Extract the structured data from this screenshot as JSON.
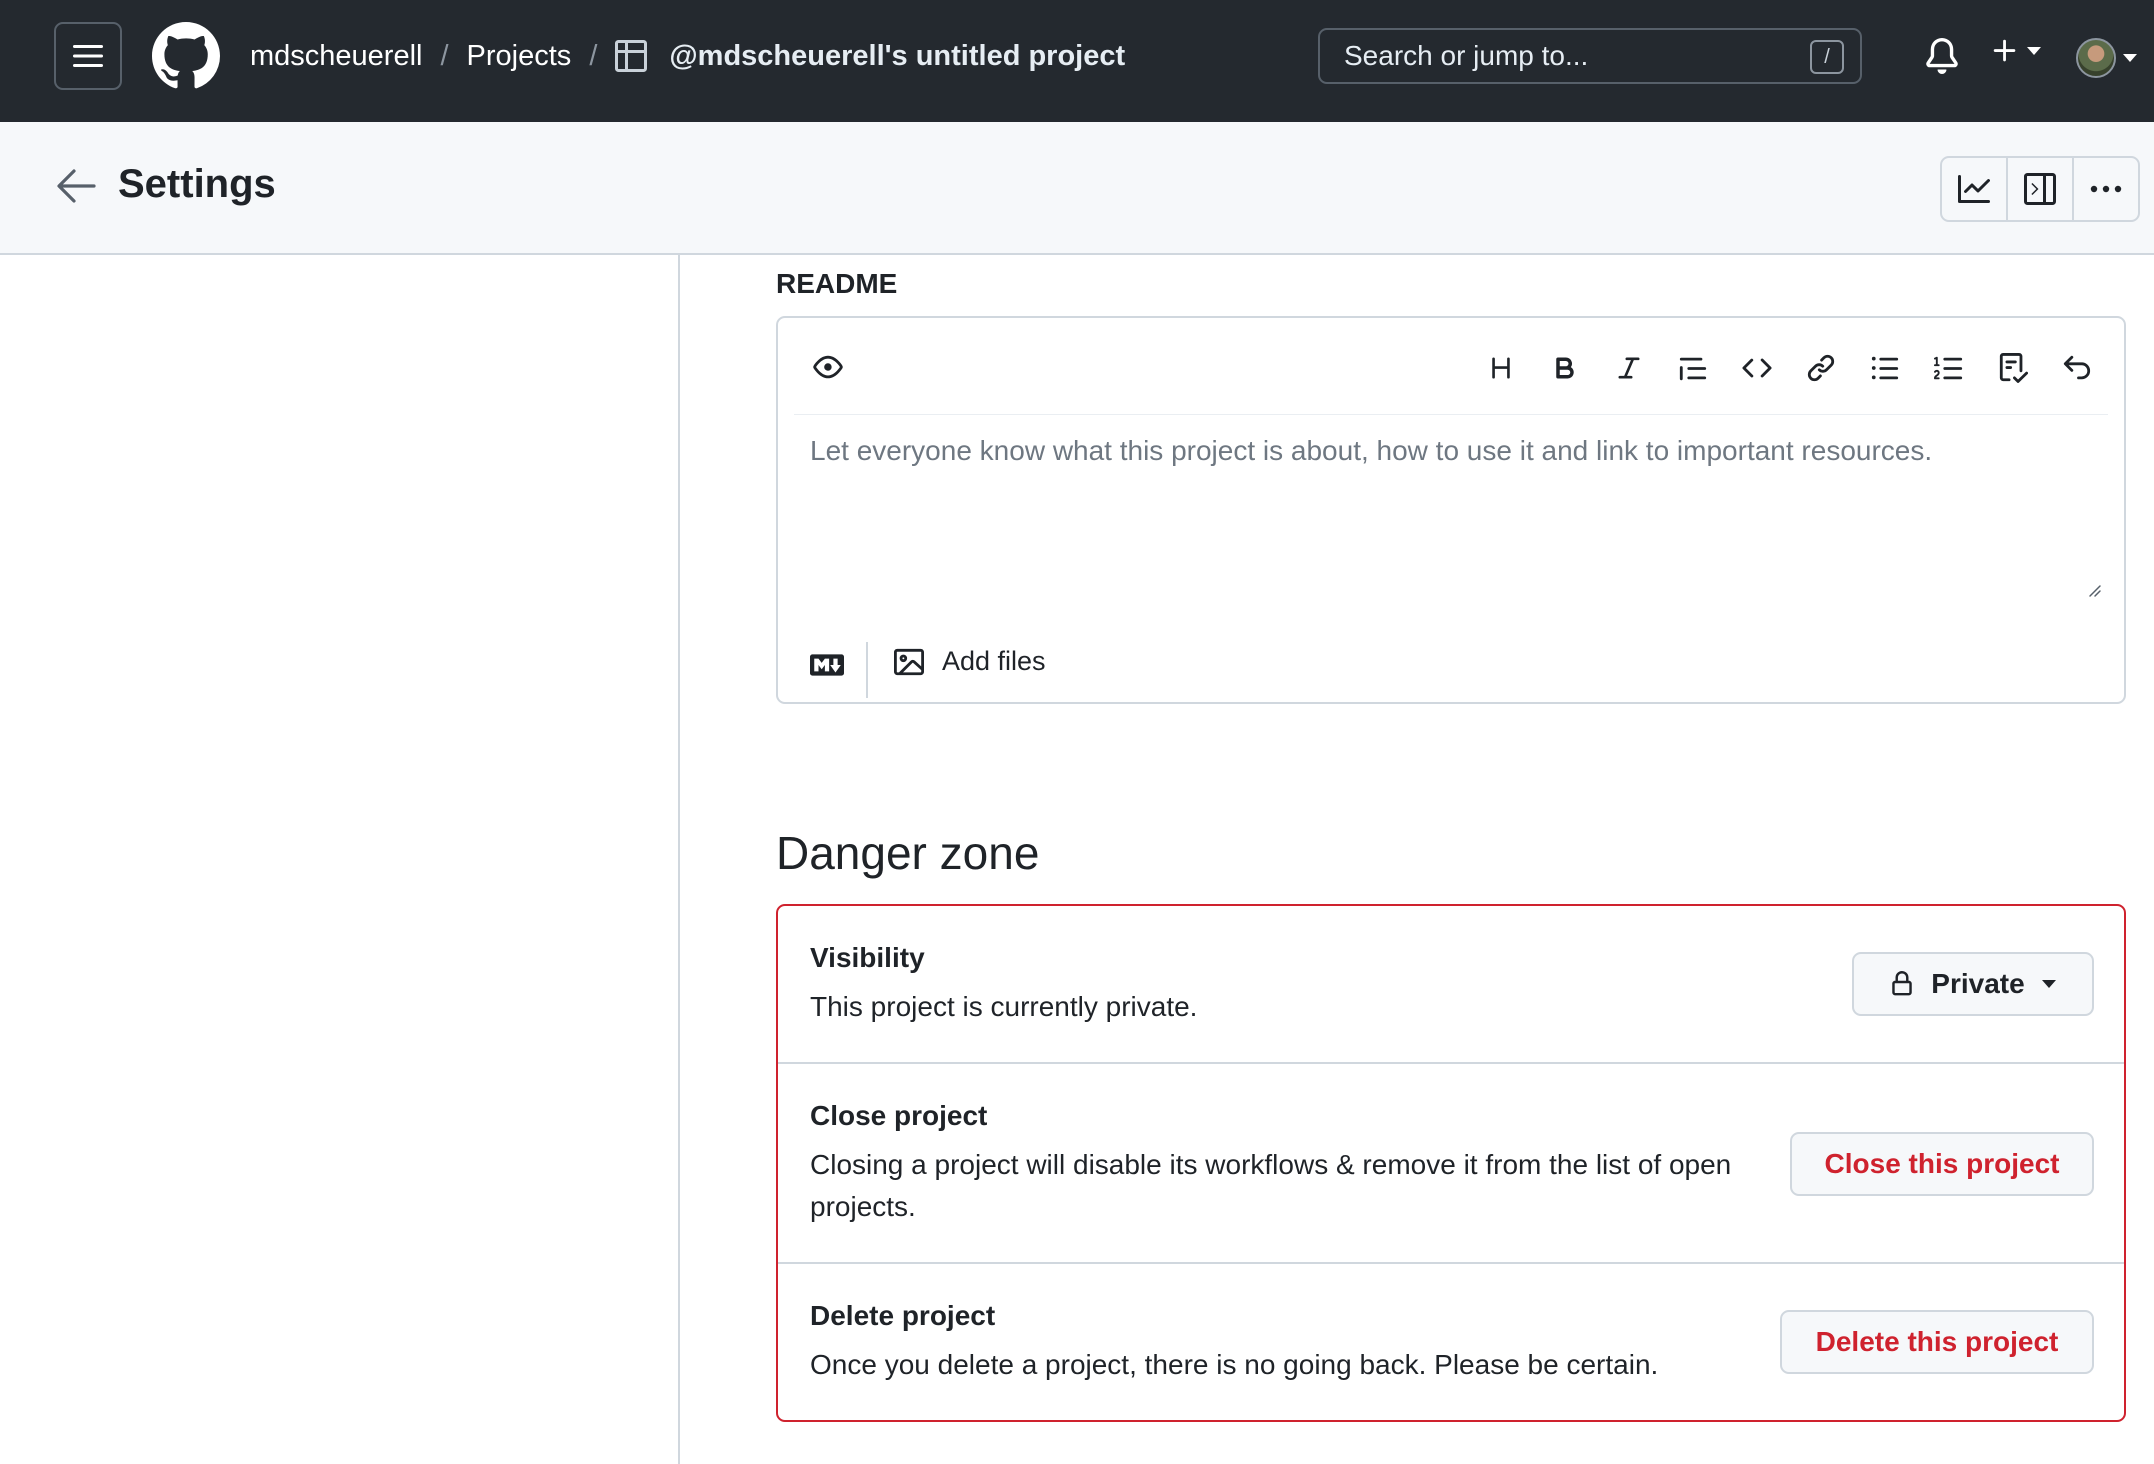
{
  "header": {
    "breadcrumb": {
      "user": "mdscheuerell",
      "separator": "/",
      "section": "Projects",
      "project": "@mdscheuerell's untitled project"
    },
    "search": {
      "placeholder": "Search or jump to...",
      "shortcut": "/"
    }
  },
  "settings_bar": {
    "title": "Settings"
  },
  "readme": {
    "label": "README",
    "placeholder": "Let everyone know what this project is about, how to use it and link to important resources.",
    "add_files_label": "Add files",
    "toolbar_icons": [
      "heading-icon",
      "bold-icon",
      "italic-icon",
      "quote-icon",
      "code-icon",
      "link-icon",
      "unordered-list-icon",
      "ordered-list-icon",
      "task-list-icon",
      "undo-icon"
    ]
  },
  "danger_zone": {
    "title": "Danger zone",
    "visibility": {
      "title": "Visibility",
      "description": "This project is currently private.",
      "button_label": "Private"
    },
    "close": {
      "title": "Close project",
      "description_line1": "Closing a project will disable its workflows & remove it from the list of open",
      "description_line2": "projects.",
      "button_label": "Close this project"
    },
    "delete": {
      "title": "Delete project",
      "description": "Once you delete a project, there is no going back. Please be certain.",
      "button_label": "Delete this project"
    }
  },
  "colors": {
    "header_bg": "#24292f",
    "danger": "#cf222e",
    "border": "#d0d7de",
    "subtle_bg": "#f6f8fa"
  }
}
